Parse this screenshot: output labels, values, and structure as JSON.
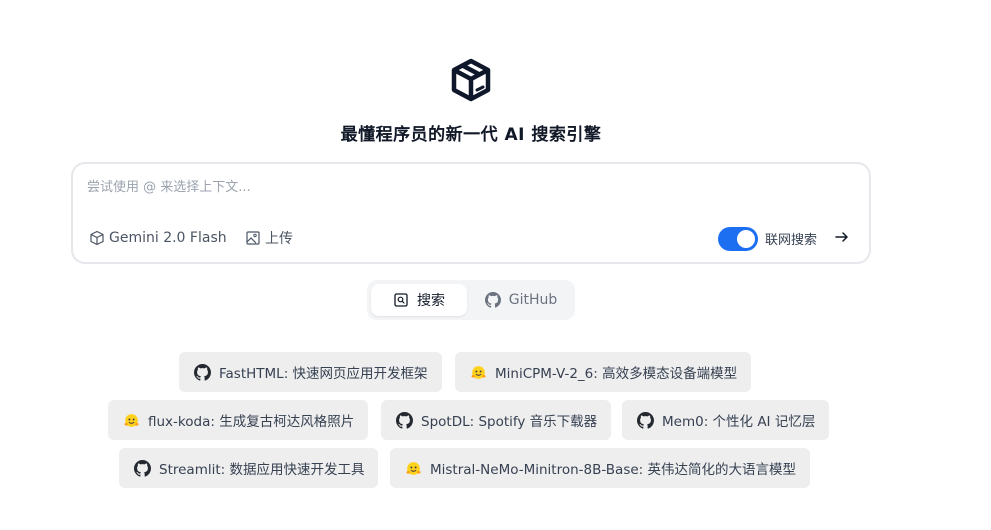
{
  "header": {
    "logo_icon": "box-icon",
    "title": "最懂程序员的新一代 AI 搜索引擎"
  },
  "search": {
    "placeholder": "尝试使用 @ 来选择上下文...",
    "value": "",
    "model_label": "Gemini 2.0 Flash",
    "upload_label": "上传",
    "web_search_label": "联网搜索",
    "web_search_enabled": true,
    "accent_color": "#1d6ff2"
  },
  "tabs": [
    {
      "label": "搜索",
      "icon": "search-icon",
      "active": true
    },
    {
      "label": "GitHub",
      "icon": "github-icon",
      "active": false
    }
  ],
  "suggestions": [
    {
      "label": "FastHTML: 快速网页应用开发框架",
      "icon": "github-icon"
    },
    {
      "label": "MiniCPM-V-2_6: 高效多模态设备端模型",
      "icon": "huggingface-icon"
    },
    {
      "label": "flux-koda: 生成复古柯达风格照片",
      "icon": "huggingface-icon"
    },
    {
      "label": "SpotDL: Spotify 音乐下载器",
      "icon": "github-icon"
    },
    {
      "label": "Mem0: 个性化 AI 记忆层",
      "icon": "github-icon"
    },
    {
      "label": "Streamlit: 数据应用快速开发工具",
      "icon": "github-icon"
    },
    {
      "label": "Mistral-NeMo-Minitron-8B-Base: 英伟达简化的大语言模型",
      "icon": "huggingface-icon"
    }
  ]
}
